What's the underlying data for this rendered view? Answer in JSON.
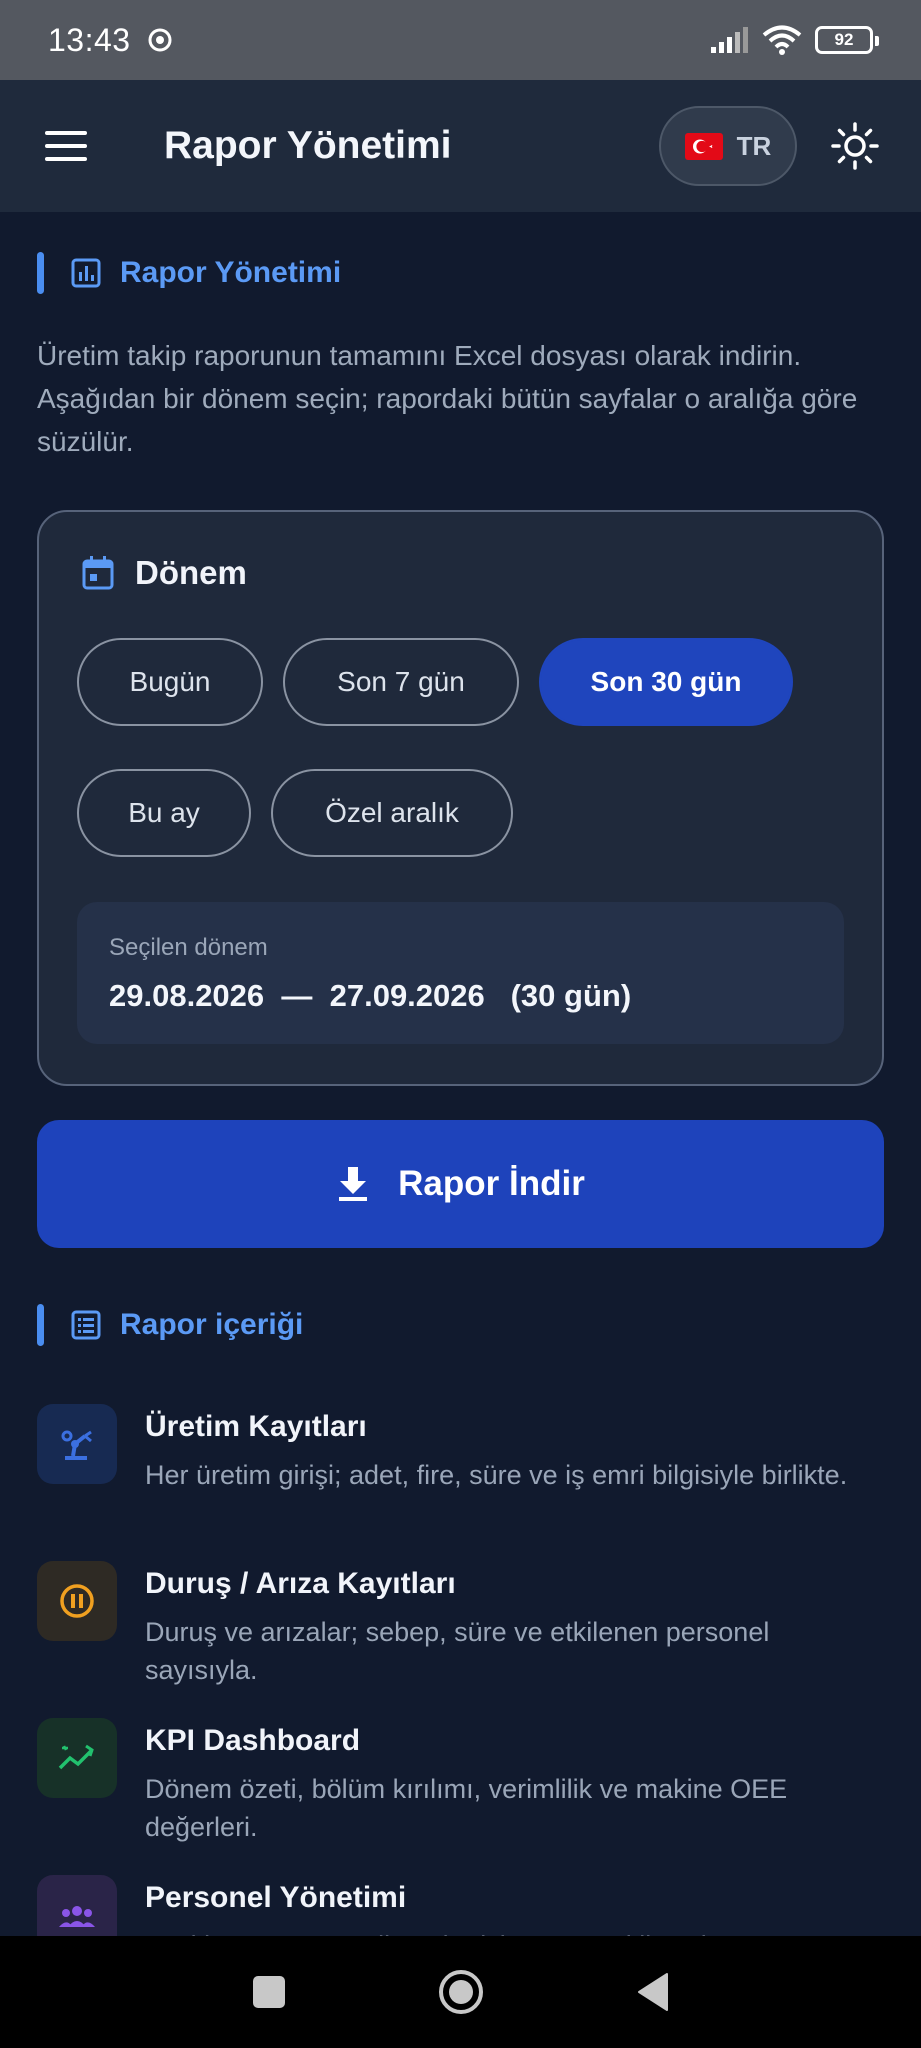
{
  "status_bar": {
    "time": "13:43",
    "battery": "92"
  },
  "app_bar": {
    "title": "Rapor Yönetimi",
    "language": "TR"
  },
  "report_section": {
    "heading": "Rapor Yönetimi",
    "intro": "Üretim takip raporunun tamamını Excel dosyası olarak indirin. Aşağıdan bir dönem seçin; rapordaki bütün sayfalar o aralığa göre süzülür."
  },
  "period_card": {
    "title": "Dönem",
    "chips": [
      {
        "label": "Bugün",
        "active": false
      },
      {
        "label": "Son 7 gün",
        "active": false
      },
      {
        "label": "Son 30 gün",
        "active": true
      },
      {
        "label": "Bu ay",
        "active": false
      },
      {
        "label": "Özel aralık",
        "active": false
      }
    ],
    "selected_caption": "Seçilen dönem",
    "selected_value": "29.08.2026  —  27.09.2026   (30 gün)"
  },
  "download_button": {
    "label": "Rapor İndir"
  },
  "contents_section": {
    "heading": "Rapor içeriği",
    "items": [
      {
        "title": "Üretim Kayıtları",
        "desc": "Her üretim girişi; adet, fire, süre ve iş emri bilgisiyle birlikte.",
        "icon": "robot-arm-icon",
        "color": "#3b6fe0"
      },
      {
        "title": "Duruş / Arıza Kayıtları",
        "desc": "Duruş ve arızalar; sebep, süre ve etkilenen personel sayısıyla.",
        "icon": "pause-circle-icon",
        "color": "#f0a020"
      },
      {
        "title": "KPI Dashboard",
        "desc": "Dönem özeti, bölüm kırılımı, verimlilik ve makine OEE değerleri.",
        "icon": "trending-up-icon",
        "color": "#22c16e"
      },
      {
        "title": "Personel Yönetimi",
        "desc": "Yeni kayıt ve güncellemeler için personel listesi.",
        "icon": "group-icon",
        "color": "#8a55e8"
      }
    ]
  },
  "colors": {
    "accent": "#1f45bd",
    "link": "#5b9af5",
    "background": "#111a2e",
    "card": "#1f293b"
  }
}
